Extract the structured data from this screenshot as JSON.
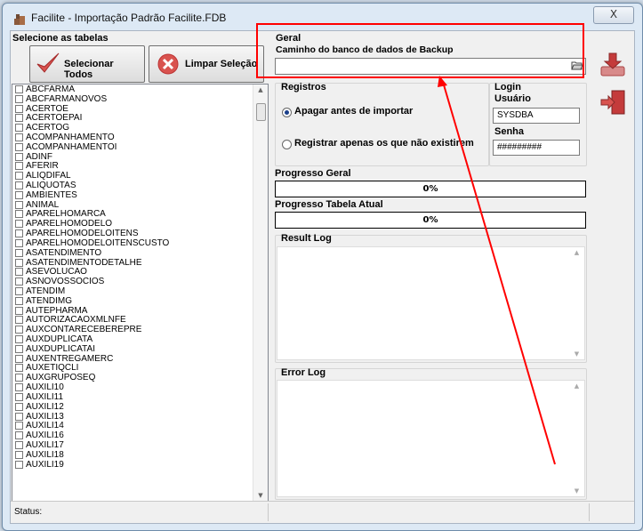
{
  "window": {
    "title": "Facilite - Importação Padrão Facilite.FDB",
    "close_label": "X"
  },
  "tables": {
    "header": "Selecione as tabelas",
    "select_all_label": "Selecionar Todos",
    "clear_label": "Limpar Seleção",
    "items": [
      "ABCFARMA",
      "ABCFARMANOVOS",
      "ACERTOE",
      "ACERTOEPAI",
      "ACERTOG",
      "ACOMPANHAMENTO",
      "ACOMPANHAMENTOI",
      "ADINF",
      "AFERIR",
      "ALIQDIFAL",
      "ALIQUOTAS",
      "AMBIENTES",
      "ANIMAL",
      "APARELHOMARCA",
      "APARELHOMODELO",
      "APARELHOMODELOITENS",
      "APARELHOMODELOITENSCUSTO",
      "ASATENDIMENTO",
      "ASATENDIMENTODETALHE",
      "ASEVOLUCAO",
      "ASNOVOSSOCIOS",
      "ATENDIM",
      "ATENDIMG",
      "AUTEPHARMA",
      "AUTORIZACAOXMLNFE",
      "AUXCONTARECEBEREPRE",
      "AUXDUPLICATA",
      "AUXDUPLICATAI",
      "AUXENTREGAMERC",
      "AUXETIQCLI",
      "AUXGRUPOSEQ",
      "AUXILI10",
      "AUXILI11",
      "AUXILI12",
      "AUXILI13",
      "AUXILI14",
      "AUXILI16",
      "AUXILI17",
      "AUXILI18",
      "AUXILI19"
    ]
  },
  "geral": {
    "header": "Geral",
    "backup_path_label": "Caminho do banco de dados de Backup",
    "backup_path_value": "",
    "folder_icon": "folder-open-icon"
  },
  "registros": {
    "header": "Registros",
    "option_delete": "Apagar antes de importar",
    "option_new_only": "Registrar apenas os que não existirem",
    "selected": "option_delete"
  },
  "login": {
    "header": "Login",
    "user_label": "Usuário",
    "user_value": "SYSDBA",
    "password_label": "Senha",
    "password_value": "#########"
  },
  "progress": {
    "overall_label": "Progresso Geral",
    "overall_value": "0%",
    "overall_fraction": 0,
    "current_label": "Progresso Tabela Atual",
    "current_value": "0%",
    "current_fraction": 0
  },
  "logs": {
    "result_label": "Result Log",
    "error_label": "Error Log"
  },
  "side_buttons": [
    {
      "name": "import-icon",
      "color": "#c43b3b"
    },
    {
      "name": "exit-door-icon",
      "color": "#c43b3b"
    }
  ],
  "status": {
    "label": "Status:"
  },
  "annotation": {
    "color": "#ff0000"
  }
}
